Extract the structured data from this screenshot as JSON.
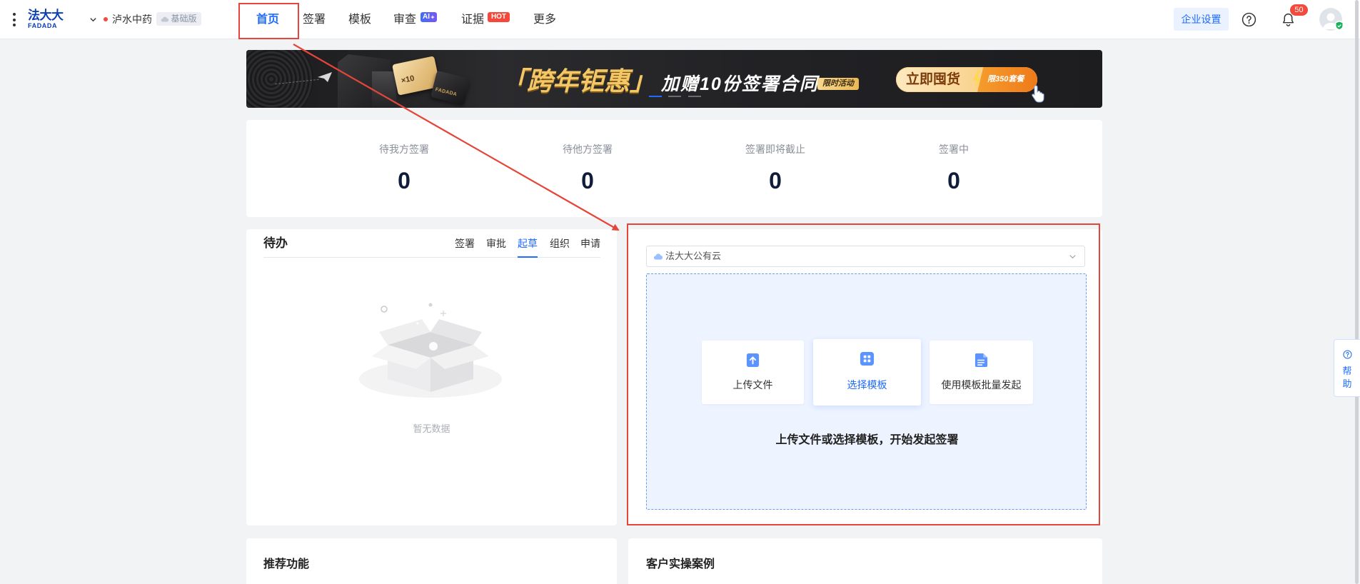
{
  "colors": {
    "accent": "#1f6bff",
    "annotation_red": "#e5453a",
    "page_bg": "#f2f3f5",
    "logo_blue": "#0b3fb4",
    "notification_red": "#f24a3d",
    "banner_gold": "#f3c766"
  },
  "nav": {
    "logo_cn": "法大大",
    "logo_en": "FADADA",
    "company_name": "泸水中药",
    "plan_badge": "基础版",
    "items": [
      {
        "label": "首页",
        "active": true
      },
      {
        "label": "签署",
        "active": false
      },
      {
        "label": "模板",
        "active": false
      },
      {
        "label": "审查",
        "active": false,
        "badge": "AI"
      },
      {
        "label": "证据",
        "active": false,
        "badge": "HOT"
      },
      {
        "label": "更多",
        "active": false
      }
    ],
    "enterprise_settings": "企业设置",
    "notification_count": "50",
    "icons": [
      "more-menu-icon",
      "chevron-down-icon",
      "cloud-icon",
      "help-icon",
      "bell-icon",
      "avatar",
      "verified-shield-icon"
    ]
  },
  "banner": {
    "headline": "「跨年钜惠」",
    "subline": "加赠10份签署合同",
    "tag": "限时活动",
    "cta": "立即囤货",
    "cta_tag": "限350套餐",
    "card_count": "×10",
    "card_brand": "FADADA",
    "carousel": [
      {
        "active": true
      },
      {
        "active": false
      },
      {
        "active": false
      }
    ]
  },
  "stats": {
    "items": [
      {
        "label": "待我方签署",
        "value": "0"
      },
      {
        "label": "待他方签署",
        "value": "0"
      },
      {
        "label": "签署即将截止",
        "value": "0"
      },
      {
        "label": "签署中",
        "value": "0"
      }
    ]
  },
  "todo": {
    "title": "待办",
    "tabs": [
      {
        "label": "签署",
        "active": false
      },
      {
        "label": "审批",
        "active": false
      },
      {
        "label": "起草",
        "active": true
      },
      {
        "label": "组织",
        "active": false
      },
      {
        "label": "申请",
        "active": false
      }
    ],
    "empty_text": "暂无数据"
  },
  "start": {
    "cloud_select": "法大大公有云",
    "actions": [
      {
        "label": "上传文件",
        "icon": "upload-file-icon",
        "active": false
      },
      {
        "label": "选择模板",
        "icon": "template-grid-icon",
        "active": true
      },
      {
        "label": "使用模板批量发起",
        "icon": "batch-document-icon",
        "active": false
      }
    ],
    "hint": "上传文件或选择模板，开始发起签署"
  },
  "sections": {
    "recommended": "推荐功能",
    "cases": "客户实操案例"
  },
  "help": {
    "char_1": "帮",
    "char_2": "助"
  }
}
